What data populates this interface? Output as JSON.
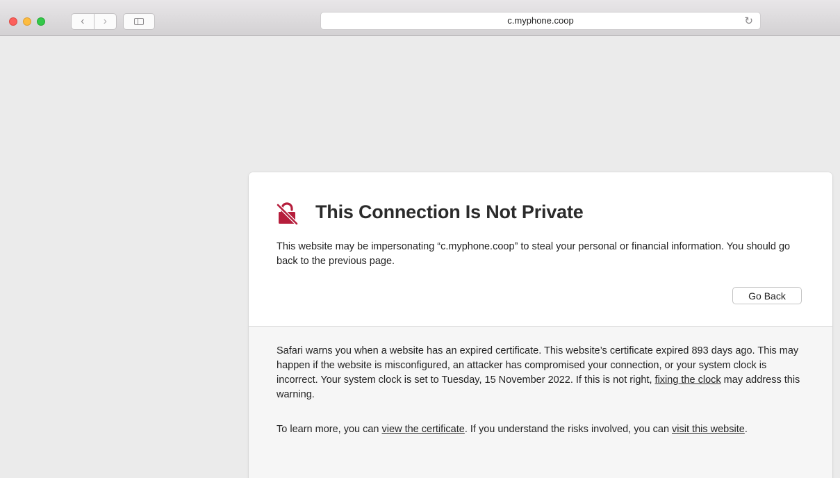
{
  "toolbar": {
    "back_glyph": "‹",
    "forward_glyph": "›",
    "address": "c.myphone.coop",
    "reload_glyph": "↻"
  },
  "warning": {
    "icon": "broken-lock-icon",
    "icon_color": "#b61e3c",
    "title": "This Connection Is Not Private",
    "intro": "This website may be impersonating “c.myphone.coop” to steal your personal or financial information. You should go back to the previous page.",
    "go_back_label": "Go Back"
  },
  "details": {
    "para1_text": "Safari warns you when a website has an expired certificate. This website’s certificate expired 893 days ago. This may happen if the website is misconfigured, an attacker has compromised your connection, or your system clock is incorrect. Your system clock is set to Tuesday, 15 November 2022. If this is not right, ",
    "fix_clock_link": "fixing the clock",
    "para1_end": " may address this warning.",
    "para2_start": "To learn more, you can ",
    "view_certificate_link": "view the certificate",
    "para2_mid": ". If you understand the risks involved, you can ",
    "visit_website_link": "visit this website",
    "para2_end": "."
  }
}
